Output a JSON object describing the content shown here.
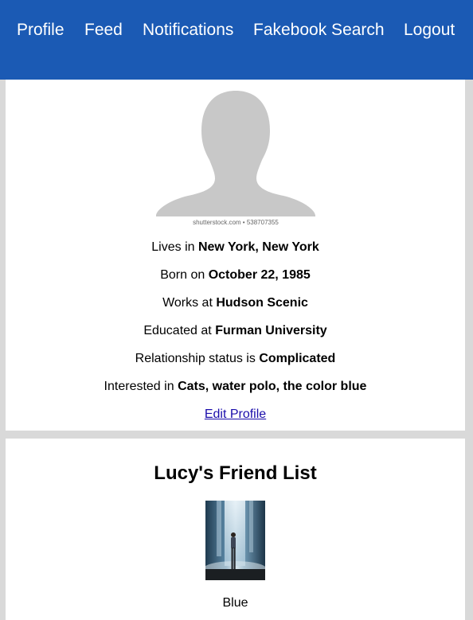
{
  "nav": {
    "items": [
      {
        "label": "Profile"
      },
      {
        "label": "Feed"
      },
      {
        "label": "Notifications"
      },
      {
        "label": "Fakebook Search"
      },
      {
        "label": "Logout"
      }
    ],
    "bg_color": "#1b5ab4"
  },
  "profile": {
    "avatar_caption": "shutterstock.com • 538707355",
    "lines": [
      {
        "prefix": "Lives in",
        "value": "New York, New York"
      },
      {
        "prefix": "Born on",
        "value": "October 22, 1985"
      },
      {
        "prefix": "Works at",
        "value": "Hudson Scenic"
      },
      {
        "prefix": "Educated at",
        "value": "Furman University"
      },
      {
        "prefix": "Relationship status is",
        "value": "Complicated"
      },
      {
        "prefix": "Interested in",
        "value": "Cats, water polo, the color blue"
      }
    ],
    "edit_label": "Edit Profile"
  },
  "friends": {
    "title": "Lucy's Friend List",
    "items": [
      {
        "name": "Blue",
        "photo_icon": "waterfall-photo"
      }
    ]
  }
}
